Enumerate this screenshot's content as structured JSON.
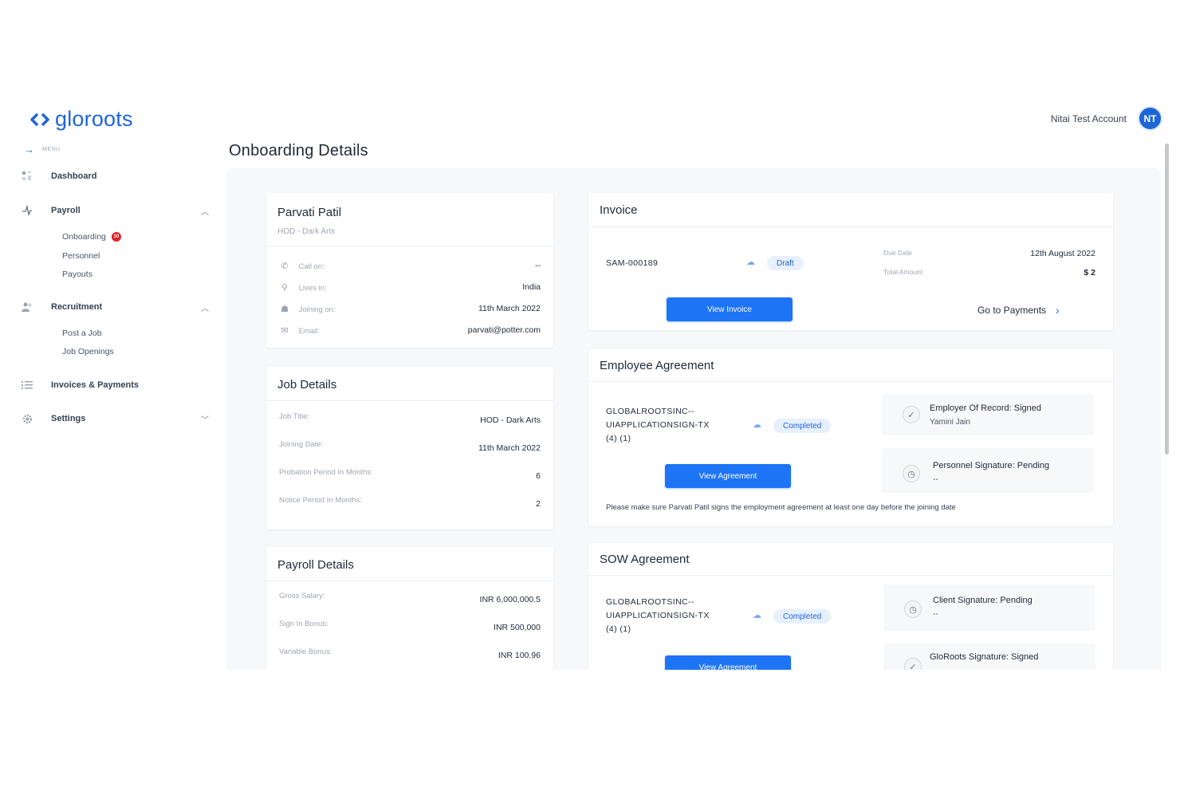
{
  "app": {
    "logo_text": "gloroots",
    "menu_label": "MENU"
  },
  "header": {
    "user_name": "Nitai Test Account",
    "avatar_initials": "NT"
  },
  "page": {
    "title": "Onboarding Details"
  },
  "sidebar": {
    "items": [
      {
        "label": "Dashboard",
        "icon": "dashboard-icon"
      },
      {
        "label": "Payroll",
        "icon": "payroll-icon"
      },
      {
        "label": "Recruitment",
        "icon": "people-icon"
      },
      {
        "label": "Invoices & Payments",
        "icon": "list-icon"
      },
      {
        "label": "Settings",
        "icon": "gear-icon"
      }
    ],
    "payroll_sub": [
      "Onboarding",
      "Personnel",
      "Payouts"
    ],
    "onboarding_badge": "10",
    "recruitment_sub": [
      "Post a Job",
      "Job Openings"
    ]
  },
  "profile": {
    "name": "Parvati Patil",
    "role": "HOD - Dark Arts",
    "rows": [
      {
        "label": "Call on:",
        "value": "--",
        "icon": "phone-icon"
      },
      {
        "label": "Lives in:",
        "value": "India",
        "icon": "location-icon"
      },
      {
        "label": "Joining on:",
        "value": "11th March 2022",
        "icon": "person-icon"
      },
      {
        "label": "Email:",
        "value": "parvati@potter.com",
        "icon": "mail-icon"
      }
    ]
  },
  "job": {
    "title": "Job Details",
    "rows": [
      {
        "label": "Job Title:",
        "value": "HOD - Dark Arts"
      },
      {
        "label": "Joining Date:",
        "value": "11th March 2022"
      },
      {
        "label": "Probation Period In Months:",
        "value": "6"
      },
      {
        "label": "Notice Period In Months:",
        "value": "2"
      }
    ]
  },
  "payroll": {
    "title": "Payroll Details",
    "rows": [
      {
        "label": "Gross Salary:",
        "value": "INR 6,000,000.5"
      },
      {
        "label": "Sign In Bonus:",
        "value": "INR 500,000"
      },
      {
        "label": "Variable Bonus:",
        "value": "INR 100.96"
      }
    ]
  },
  "invoice": {
    "title": "Invoice",
    "id": "SAM-000189",
    "status": "Draft",
    "due_date_label": "Due Date",
    "due_date": "12th August 2022",
    "total_label": "Total Amount",
    "total": "$ 2",
    "view_button": "View Invoice",
    "payments_link": "Go to Payments"
  },
  "employee_agreement": {
    "title": "Employee Agreement",
    "name_lines": [
      "GLOBALROOTSINC--",
      "UIAPPLICATIONSIGN-TX",
      "(4) (1)"
    ],
    "status": "Completed",
    "view_button": "View Agreement",
    "sig1_title": "Employer Of Record: Signed",
    "sig1_sub": "Yamini Jain",
    "sig2_title": "Personnel Signature: Pending",
    "sig2_sub": "--",
    "note": "Please make sure Parvati Patil signs the employment agreement at least one day before the joining date"
  },
  "sow_agreement": {
    "title": "SOW Agreement",
    "name_lines": [
      "GLOBALROOTSINC--",
      "UIAPPLICATIONSIGN-TX",
      "(4) (1)"
    ],
    "status": "Completed",
    "view_button": "View Agreement",
    "sig1_title": "Client Signature: Pending",
    "sig1_sub": "--",
    "sig2_title": "GloRoots Signature: Signed"
  },
  "colors": {
    "brand": "#1d66d6",
    "button": "#1d74f5",
    "badge": "#dc2626"
  }
}
